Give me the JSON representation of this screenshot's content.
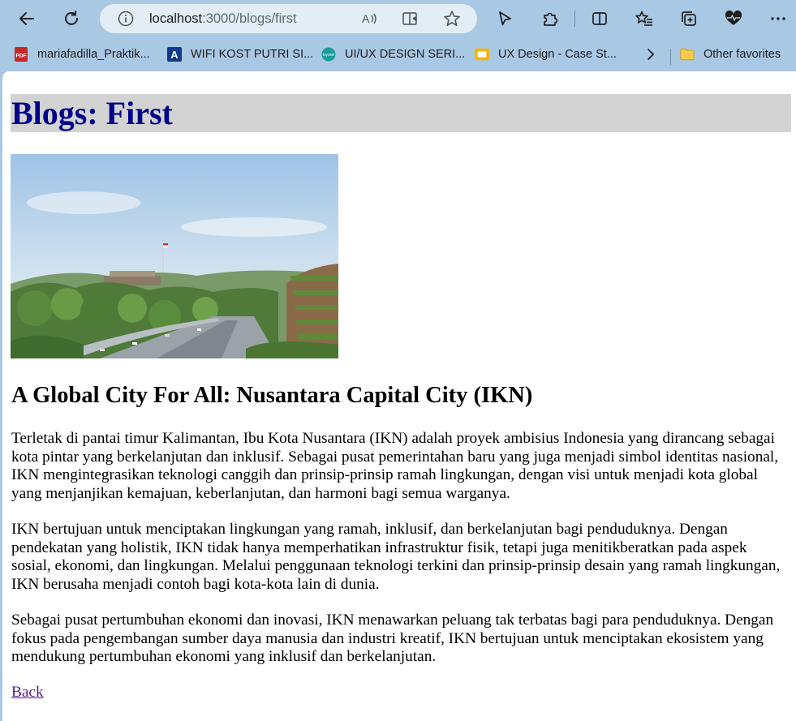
{
  "browser": {
    "url_host": "localhost",
    "url_path": ":3000/blogs/first",
    "bookmarks": [
      {
        "label": "mariafadilla_Praktik...",
        "icon": "pdf-icon"
      },
      {
        "label": "WIFI KOST PUTRI SI...",
        "icon": "letter-a-icon"
      },
      {
        "label": "UI/UX DESIGN SERI...",
        "icon": "mysql-icon"
      },
      {
        "label": "UX Design - Case St...",
        "icon": "slides-icon"
      }
    ],
    "other_favorites": "Other favorites"
  },
  "page": {
    "header": "Blogs: First",
    "article_title": "A Global City For All: Nusantara Capital City (IKN)",
    "paragraphs": [
      "Terletak di pantai timur Kalimantan, Ibu Kota Nusantara (IKN) adalah proyek ambisius Indonesia yang dirancang sebagai kota pintar yang berkelanjutan dan inklusif. Sebagai pusat pemerintahan baru yang juga menjadi simbol identitas nasional, IKN mengintegrasikan teknologi canggih dan prinsip-prinsip ramah lingkungan, dengan visi untuk menjadi kota global yang menjanjikan kemajuan, keberlanjutan, dan harmoni bagi semua warganya.",
      "IKN bertujuan untuk menciptakan lingkungan yang ramah, inklusif, dan berkelanjutan bagi penduduknya. Dengan pendekatan yang holistik, IKN tidak hanya memperhatikan infrastruktur fisik, tetapi juga menitikberatkan pada aspek sosial, ekonomi, dan lingkungan. Melalui penggunaan teknologi terkini dan prinsip-prinsip desain yang ramah lingkungan, IKN berusaha menjadi contoh bagi kota-kota lain di dunia.",
      "Sebagai pusat pertumbuhan ekonomi dan inovasi, IKN menawarkan peluang tak terbatas bagi para penduduknya. Dengan fokus pada pengembangan sumber daya manusia dan industri kreatif, IKN bertujuan untuk menciptakan ekosistem yang mendukung pertumbuhan ekonomi yang inklusif dan berkelanjutan."
    ],
    "back_link": "Back"
  },
  "colors": {
    "chrome_bg": "#a9c8e4",
    "header_bg": "#d3d3d3",
    "header_text": "#00008b",
    "visited_link": "#551a8b"
  }
}
